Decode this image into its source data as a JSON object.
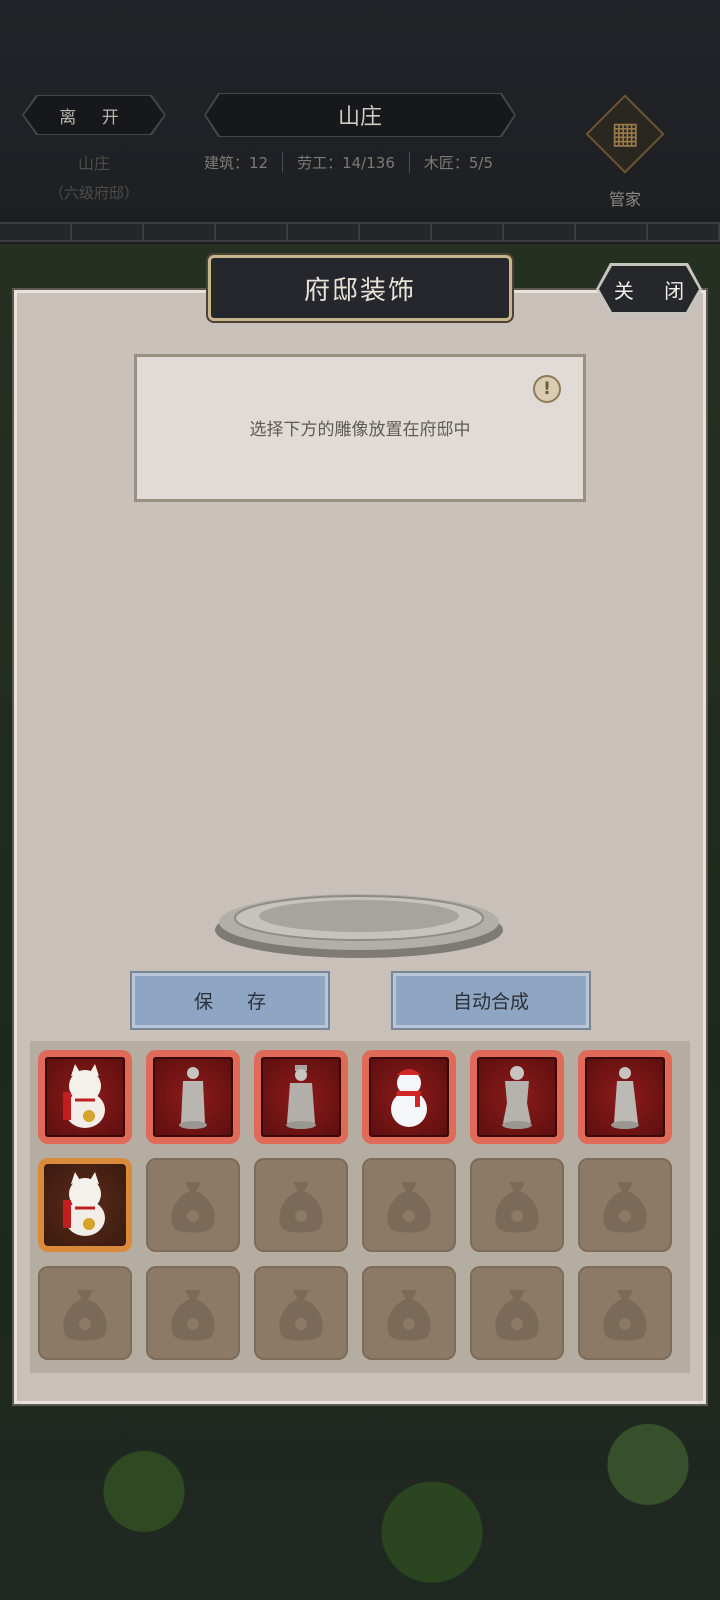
{
  "header": {
    "leave_label": "离 开",
    "title": "山庄",
    "location_name": "山庄",
    "location_rank": "（六级府邸）",
    "stats": [
      {
        "label": "建筑：12"
      },
      {
        "label": "劳工：14/136"
      },
      {
        "label": "木匠：5/5"
      }
    ],
    "steward_label": "管家"
  },
  "panel": {
    "title": "府邸装饰",
    "close_label": "关 闭",
    "info_text": "选择下方的雕像放置在府邸中",
    "info_icon": "!",
    "save_label": "保 存",
    "auto_merge_label": "自动合成"
  },
  "inventory": {
    "slots": [
      {
        "item": "lucky-cat",
        "frame": "red"
      },
      {
        "item": "scholar-statue",
        "frame": "red"
      },
      {
        "item": "official-statue",
        "frame": "red"
      },
      {
        "item": "snowman",
        "frame": "red"
      },
      {
        "item": "general-statue",
        "frame": "red"
      },
      {
        "item": "sage-statue",
        "frame": "red"
      },
      {
        "item": "lucky-cat",
        "frame": "orange"
      },
      {
        "item": "empty"
      },
      {
        "item": "empty"
      },
      {
        "item": "empty"
      },
      {
        "item": "empty"
      },
      {
        "item": "empty"
      },
      {
        "item": "empty"
      },
      {
        "item": "empty"
      },
      {
        "item": "empty"
      },
      {
        "item": "empty"
      },
      {
        "item": "empty"
      },
      {
        "item": "empty"
      }
    ]
  }
}
